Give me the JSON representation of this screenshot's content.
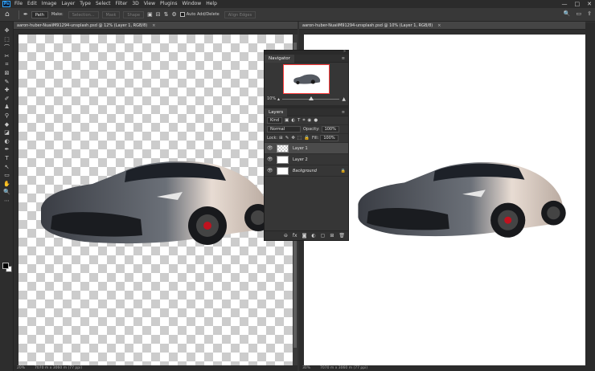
{
  "app": {
    "logo": "Ps",
    "menu": [
      "File",
      "Edit",
      "Image",
      "Layer",
      "Type",
      "Select",
      "Filter",
      "3D",
      "View",
      "Plugins",
      "Window",
      "Help"
    ],
    "window_controls": [
      "—",
      "□",
      "✕"
    ]
  },
  "options_bar": {
    "mode": "Path",
    "make_label": "Make:",
    "buttons": [
      "Selection...",
      "Mask",
      "Shape"
    ],
    "auto_add_delete": "Auto Add/Delete",
    "align_edges": "Align Edges",
    "right_icons": [
      "🔍",
      "▭",
      "⇪"
    ]
  },
  "tools": [
    "✥",
    "⬚",
    "⌒",
    "✂",
    "⌗",
    "⊠",
    "✎",
    "✚",
    "✐",
    "♟",
    "⚲",
    "◆",
    "◪",
    "◐",
    "✒",
    "T",
    "↖",
    "▭",
    "✋",
    "🔍",
    "⋯"
  ],
  "documents": [
    {
      "tab": "aaron-huber-NuaiiM91294-unsplash.psd @ 12% (Layer 1, RGB/8)",
      "close": "×",
      "status_zoom": "20%",
      "status_dims": "7070 m x 3060 m (77 ppi)"
    },
    {
      "tab": "aaron-huber-NuaiiM91294-unsplash.psd @ 10% (Layer 1, RGB/8)",
      "close": "×",
      "status_zoom": "30%",
      "status_dims": "7070 m x 3060 m (77 ppi)"
    }
  ],
  "navigator": {
    "title": "Navigator",
    "zoom": "10%",
    "zoom_fraction": 0.5
  },
  "layers_panel": {
    "title": "Layers",
    "filter": "Kind",
    "filter_icons": [
      "▣",
      "◐",
      "T",
      "⌗",
      "◉",
      "●"
    ],
    "blend_mode": "Normal",
    "opacity_label": "Opacity:",
    "opacity": "100%",
    "lock_label": "Lock:",
    "lock_icons": [
      "⊞",
      "✎",
      "✥",
      "⬚",
      "🔒"
    ],
    "fill_label": "Fill:",
    "fill": "100%",
    "layers": [
      {
        "name": "Layer 1",
        "visible": "👁",
        "selected": true
      },
      {
        "name": "Layer 2",
        "visible": "👁",
        "selected": false
      },
      {
        "name": "Background",
        "visible": "👁",
        "selected": false,
        "locked": "🔒"
      }
    ],
    "footer_icons": [
      "⊖",
      "fx",
      "◙",
      "◐",
      "▢",
      "⊞",
      "🗑"
    ]
  },
  "colors": {
    "ui_dark": "#323232",
    "accent_nav_frame": "#ff3d3d",
    "canvas_white": "#ffffff"
  }
}
